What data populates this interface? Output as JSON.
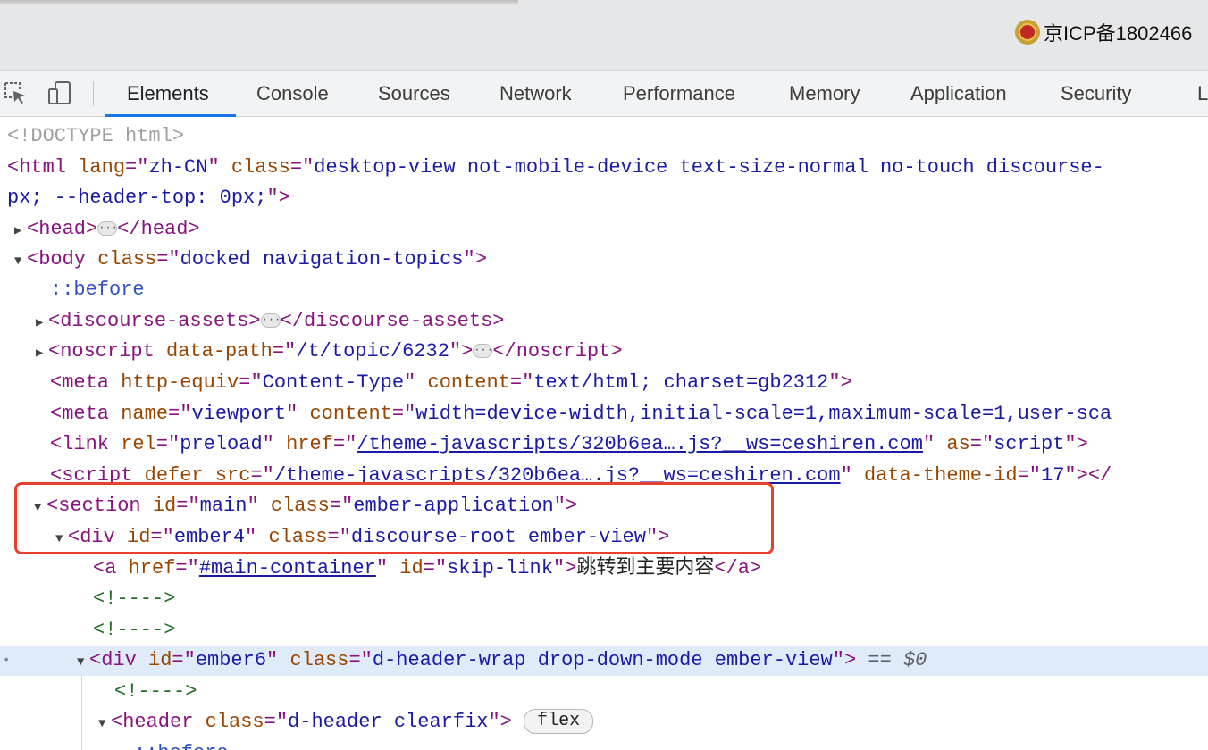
{
  "top": {
    "icp_text": "京ICP备1802466"
  },
  "toolbar": {
    "tabs": [
      {
        "label": "Elements",
        "active": true
      },
      {
        "label": "Console"
      },
      {
        "label": "Sources"
      },
      {
        "label": "Network"
      },
      {
        "label": "Performance"
      },
      {
        "label": "Memory"
      },
      {
        "label": "Application"
      },
      {
        "label": "Security"
      },
      {
        "label": "L"
      }
    ]
  },
  "colors": {
    "accent": "#1a73e8",
    "highlight": "#e8402c",
    "selected_row": "#e0ebfa"
  },
  "dom": {
    "doctype": "<!DOCTYPE html>",
    "html_open": "<html",
    "html_lang_attr": "lang",
    "html_lang_val": "zh-CN",
    "html_class_attr": "class",
    "html_class_val": "desktop-view not-mobile-device text-size-normal no-touch discourse-",
    "html_cont": "px; --header-top: 0px;",
    "html_cont_close": ">",
    "head_open": "<head>",
    "head_close": "</head>",
    "body_open": "<body",
    "body_class_attr": "class",
    "body_class_val": "docked navigation-topics",
    "body_close_bracket": ">",
    "before": "::before",
    "assets_open": "<discourse-assets>",
    "assets_close": "</discourse-assets>",
    "noscript_open": "<noscript",
    "noscript_attr": "data-path",
    "noscript_val": "/t/topic/6232",
    "noscript_close": "</noscript>",
    "meta1_open": "<meta",
    "meta1_attr1": "http-equiv",
    "meta1_val1": "Content-Type",
    "meta1_attr2": "content",
    "meta1_val2": "text/html; charset=gb2312",
    "meta2_open": "<meta",
    "meta2_attr1": "name",
    "meta2_val1": "viewport",
    "meta2_attr2": "content",
    "meta2_val2": "width=device-width,initial-scale=1,maximum-scale=1,user-sca",
    "link_open": "<link",
    "link_attr1": "rel",
    "link_val1": "preload",
    "link_attr2": "href",
    "link_val2": "/theme-javascripts/320b6ea….js?__ws=ceshiren.com",
    "link_attr3": "as",
    "link_val3": "script",
    "script_open": "<script",
    "script_attr1": "defer",
    "script_attr2": "src",
    "script_val2": "/theme-javascripts/320b6ea….js?__ws=ceshiren.com",
    "script_attr3": "data-theme-id",
    "script_val3": "17",
    "script_close": "></",
    "section_open": "<section",
    "section_attr1": "id",
    "section_val1": "main",
    "section_attr2": "class",
    "section_val2": "ember-application",
    "div4_open": "<div",
    "div4_attr1": "id",
    "div4_val1": "ember4",
    "div4_attr2": "class",
    "div4_val2": "discourse-root ember-view",
    "a_open": "<a",
    "a_attr1": "href",
    "a_val1": "#main-container",
    "a_attr2": "id",
    "a_val2": "skip-link",
    "a_text": "跳转到主要内容",
    "a_close": "</a>",
    "comment": "<!---->",
    "div6_open": "<div",
    "div6_attr1": "id",
    "div6_val1": "ember6",
    "div6_attr2": "class",
    "div6_val2": "d-header-wrap drop-down-mode ember-view",
    "eq_text": "== ",
    "dollar_text": "$0",
    "header_open": "<header",
    "header_attr": "class",
    "header_val": "d-header clearfix",
    "flex_badge": "flex",
    "before2": "::before"
  }
}
